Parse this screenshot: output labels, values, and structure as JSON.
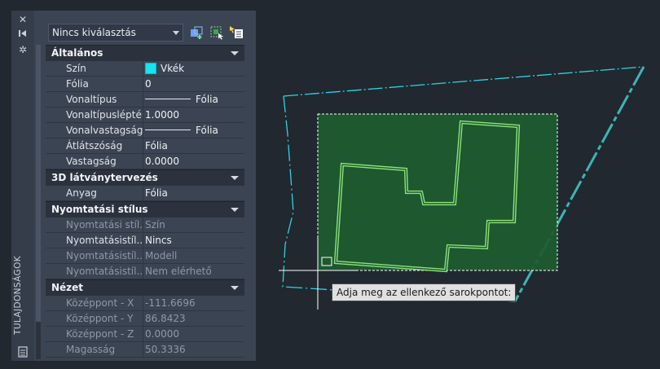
{
  "palette": {
    "title": "TULAJDONSÁGOK",
    "selection": "Nincs kiválasztás",
    "categories": [
      {
        "name": "Általános",
        "rows": [
          {
            "key": "Szín",
            "value": "Vkék",
            "kind": "color"
          },
          {
            "key": "Fólia",
            "value": "0"
          },
          {
            "key": "Vonaltípus",
            "value": "Fólia",
            "kind": "line"
          },
          {
            "key": "Vonaltípuslépték",
            "value": "1.0000"
          },
          {
            "key": "Vonalvastagság",
            "value": "Fólia",
            "kind": "line"
          },
          {
            "key": "Átlátszóság",
            "value": "Fólia"
          },
          {
            "key": "Vastagság",
            "value": "0.0000"
          }
        ]
      },
      {
        "name": "3D látványtervezés",
        "rows": [
          {
            "key": "Anyag",
            "value": "Fólia"
          }
        ]
      },
      {
        "name": "Nyomtatási stílus",
        "rows": [
          {
            "key": "Nyomtatási stíl...",
            "value": "Szín",
            "dim": true
          },
          {
            "key": "Nyomtatásistíl...",
            "value": "Nincs"
          },
          {
            "key": "Nyomtatásistíl...",
            "value": "Modell",
            "dim": true
          },
          {
            "key": "Nyomtatásistíl...",
            "value": "Nem elérhető",
            "dim": true
          }
        ]
      },
      {
        "name": "Nézet",
        "rows": [
          {
            "key": "Középpont - X",
            "value": "-111.6696",
            "dim": true
          },
          {
            "key": "Középpont - Y",
            "value": "86.8423",
            "dim": true
          },
          {
            "key": "Középpont - Z",
            "value": "0.0000",
            "dim": true
          },
          {
            "key": "Magasság",
            "value": "50.3336",
            "dim": true
          }
        ]
      }
    ]
  },
  "canvas": {
    "prompt": "Adja meg az ellenkező sarokpontot:",
    "colors": {
      "background": "#212830",
      "selection_fill": "#1d5c30",
      "building_outline": "#7ed36c",
      "parcel_line": "#2fd3e0",
      "parcel_line_heavy": "#3bb6b4"
    }
  },
  "icons": [
    "close-icon",
    "autohide-icon",
    "settings-icon",
    "quick-select-icon",
    "select-objects-icon",
    "pickadd-toggle-icon",
    "properties-palette-icon"
  ]
}
